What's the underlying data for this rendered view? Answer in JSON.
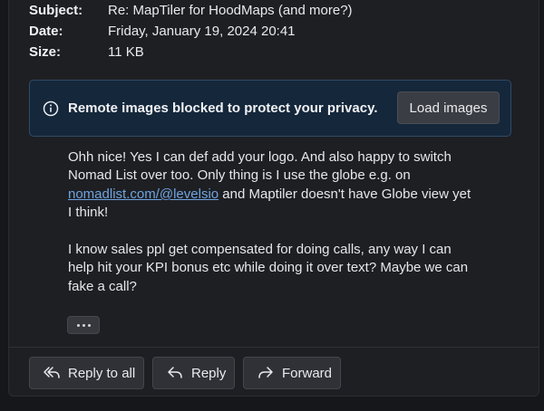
{
  "headers": {
    "subject_label": "Subject:",
    "subject_value": "Re: MapTiler for HoodMaps (and more?)",
    "date_label": "Date:",
    "date_value": "Friday, January 19, 2024 20:41",
    "size_label": "Size:",
    "size_value": "11 KB"
  },
  "notice": {
    "icon": "info-icon",
    "text": "Remote images blocked to protect your privacy.",
    "button_label": "Load images"
  },
  "body": {
    "p1_line1": "Ohh nice! Yes I can def add your logo. And also happy to switch",
    "p1_line2": "Nomad List over too. Only thing is I use the globe e.g. on",
    "p1_link": "nomadlist.com/@levelsio",
    "p1_line3_rest": " and Maptiler doesn't have Globe view yet",
    "p1_line4": "I think!",
    "p2_line1": "I know sales ppl get compensated for doing calls, any way I can",
    "p2_line2": "help hit your KPI bonus etc while doing it over text? Maybe we can",
    "p2_line3": "fake a call?",
    "more_icon": "ellipsis-icon"
  },
  "actions": {
    "reply_all_label": "Reply to all",
    "reply_label": "Reply",
    "forward_label": "Forward",
    "reply_all_icon": "reply-all-icon",
    "reply_icon": "reply-icon",
    "forward_icon": "forward-icon"
  },
  "colors": {
    "background": "#16171a",
    "panel": "#1e1f23",
    "notice_bg": "#15273a",
    "notice_border": "#2f4b69",
    "link": "#6ea4e0",
    "button_bg": "#2f3136"
  }
}
